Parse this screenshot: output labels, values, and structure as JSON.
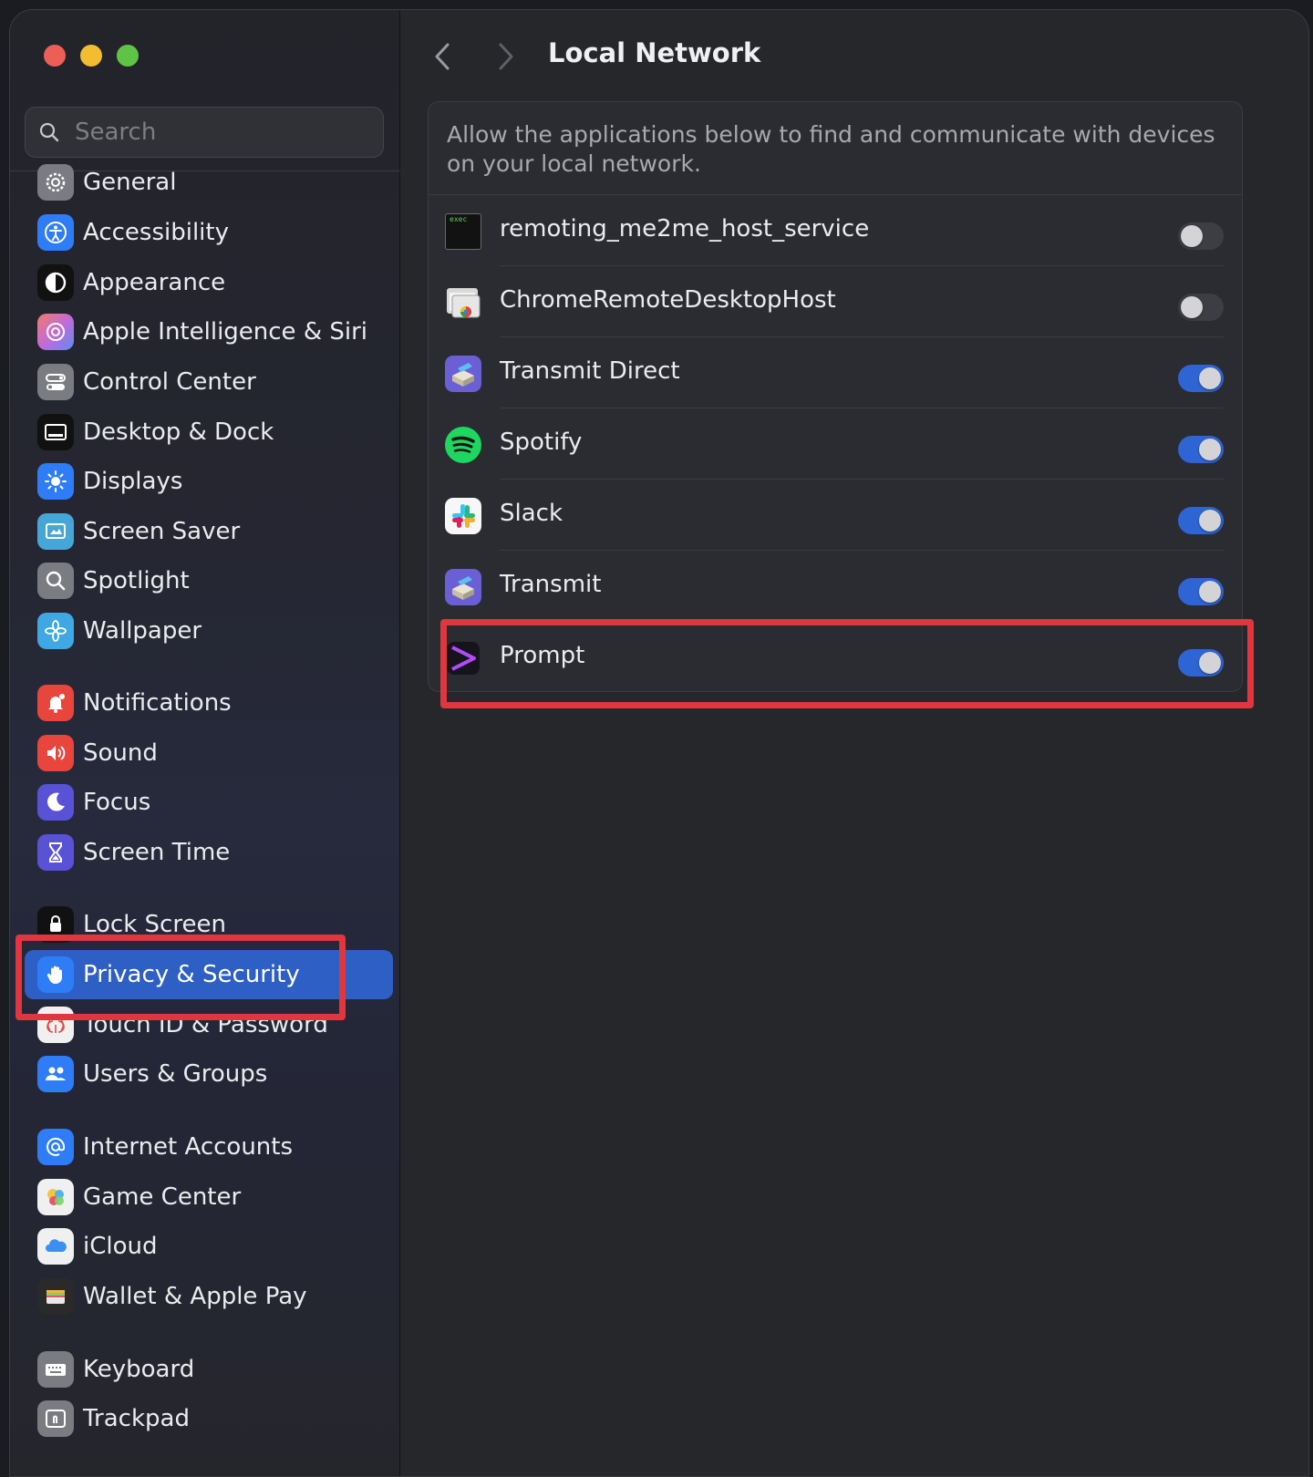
{
  "window": {
    "traffic_lights": {
      "close": "#ec5f57",
      "minimize": "#f3bd30",
      "zoom": "#5fc446"
    }
  },
  "sidebar": {
    "search_placeholder": "Search",
    "items": [
      {
        "id": "general",
        "label": "General",
        "icon": "gear-icon",
        "color": "#7b7c82"
      },
      {
        "id": "accessibility",
        "label": "Accessibility",
        "icon": "accessibility-icon",
        "color": "#2f7df6"
      },
      {
        "id": "appearance",
        "label": "Appearance",
        "icon": "appearance-icon",
        "color": "#111111"
      },
      {
        "id": "siri",
        "label": "Apple Intelligence & Siri",
        "icon": "siri-icon",
        "color": "#c46ad6"
      },
      {
        "id": "control-center",
        "label": "Control Center",
        "icon": "control-center-icon",
        "color": "#7b7c82"
      },
      {
        "id": "desktop-dock",
        "label": "Desktop & Dock",
        "icon": "dock-icon",
        "color": "#111111"
      },
      {
        "id": "displays",
        "label": "Displays",
        "icon": "sun-icon",
        "color": "#2f7df6"
      },
      {
        "id": "screen-saver",
        "label": "Screen Saver",
        "icon": "screen-saver-icon",
        "color": "#47a6d8"
      },
      {
        "id": "spotlight",
        "label": "Spotlight",
        "icon": "magnifier-icon",
        "color": "#7b7c82"
      },
      {
        "id": "wallpaper",
        "label": "Wallpaper",
        "icon": "flower-icon",
        "color": "#3fa7e3"
      },
      {
        "id": "notifications",
        "label": "Notifications",
        "icon": "bell-icon",
        "color": "#e8453c"
      },
      {
        "id": "sound",
        "label": "Sound",
        "icon": "speaker-icon",
        "color": "#e8453c"
      },
      {
        "id": "focus",
        "label": "Focus",
        "icon": "moon-icon",
        "color": "#5a52d6"
      },
      {
        "id": "screen-time",
        "label": "Screen Time",
        "icon": "hourglass-icon",
        "color": "#5a52d6"
      },
      {
        "id": "lock-screen",
        "label": "Lock Screen",
        "icon": "lock-icon",
        "color": "#111111"
      },
      {
        "id": "privacy-security",
        "label": "Privacy & Security",
        "icon": "hand-icon",
        "color": "#2f7df6"
      },
      {
        "id": "touch-id",
        "label": "Touch ID & Password",
        "icon": "fingerprint-icon",
        "color": "#f0f0f0"
      },
      {
        "id": "users-groups",
        "label": "Users & Groups",
        "icon": "users-icon",
        "color": "#2f7df6"
      },
      {
        "id": "internet-accounts",
        "label": "Internet Accounts",
        "icon": "at-icon",
        "color": "#2f7df6"
      },
      {
        "id": "game-center",
        "label": "Game Center",
        "icon": "game-center-icon",
        "color": "#f0f0f0"
      },
      {
        "id": "icloud",
        "label": "iCloud",
        "icon": "cloud-icon",
        "color": "#f0f0f0"
      },
      {
        "id": "wallet",
        "label": "Wallet & Apple Pay",
        "icon": "wallet-icon",
        "color": "#2a2a2a"
      },
      {
        "id": "keyboard",
        "label": "Keyboard",
        "icon": "keyboard-icon",
        "color": "#7b7c82"
      },
      {
        "id": "trackpad",
        "label": "Trackpad",
        "icon": "trackpad-icon",
        "color": "#7b7c82"
      }
    ],
    "selected": "privacy-security"
  },
  "header": {
    "title": "Local Network"
  },
  "card": {
    "description": "Allow the applications below to find and communicate with devices on your local network.",
    "apps": [
      {
        "name": "remoting_me2me_host_service",
        "icon": "exec-icon",
        "enabled": false
      },
      {
        "name": "ChromeRemoteDesktopHost",
        "icon": "chrome-remote-desktop-icon",
        "enabled": false
      },
      {
        "name": "Transmit Direct",
        "icon": "transmit-icon",
        "enabled": true
      },
      {
        "name": "Spotify",
        "icon": "spotify-icon",
        "enabled": true
      },
      {
        "name": "Slack",
        "icon": "slack-icon",
        "enabled": true
      },
      {
        "name": "Transmit",
        "icon": "transmit-icon",
        "enabled": true
      },
      {
        "name": "Prompt",
        "icon": "prompt-icon",
        "enabled": true
      }
    ]
  },
  "exec_icon_text": "exec",
  "colors": {
    "accent": "#2e64d4",
    "highlight": "#e0363e"
  }
}
